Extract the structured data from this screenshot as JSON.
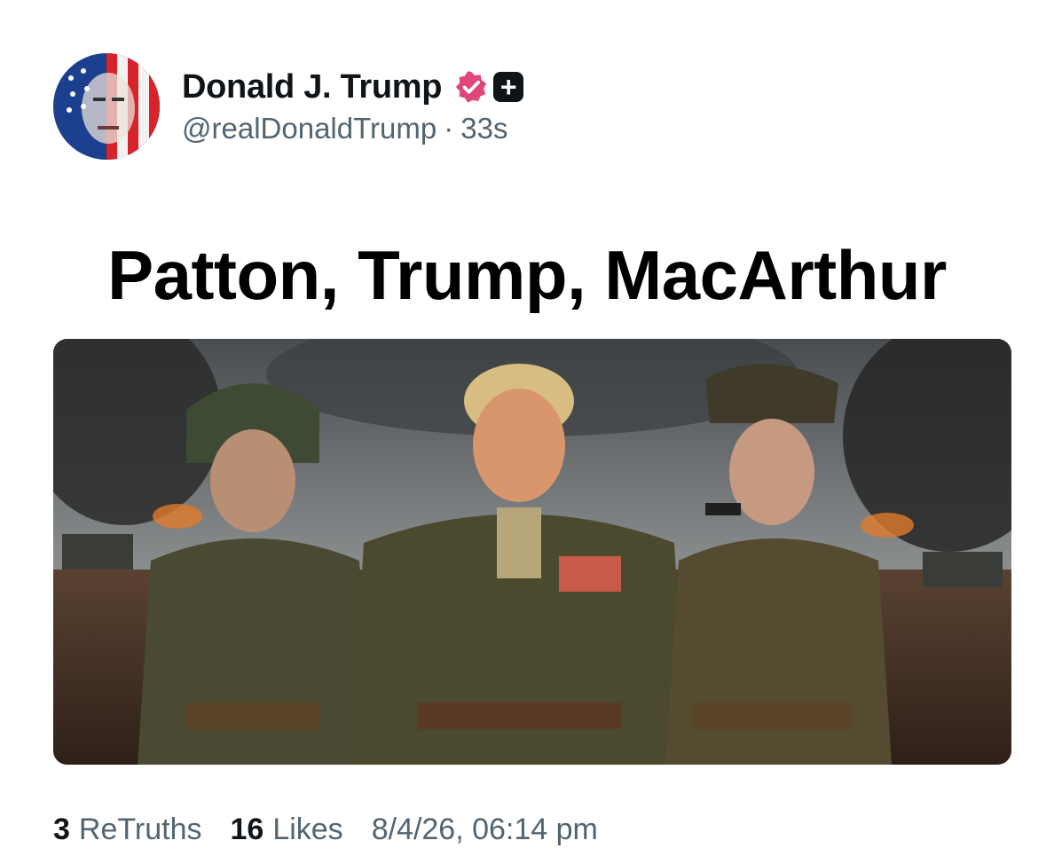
{
  "post": {
    "author": {
      "display_name": "Donald J. Trump",
      "handle": "@realDonaldTrump",
      "age": "33s",
      "separator": "·",
      "verified_icon": "verified-badge-icon",
      "plus_icon": "plus-icon",
      "plus_symbol": "+"
    },
    "caption": "Patton, Trump, MacArthur",
    "media": {
      "alt": ""
    },
    "stats": {
      "retruths_count": "3",
      "retruths_label": "ReTruths",
      "likes_count": "16",
      "likes_label": "Likes",
      "timestamp": "8/4/26, 06:14 pm"
    }
  },
  "colors": {
    "verified": "#e0457b",
    "muted_text": "#536471",
    "primary_text": "#0f1419"
  }
}
